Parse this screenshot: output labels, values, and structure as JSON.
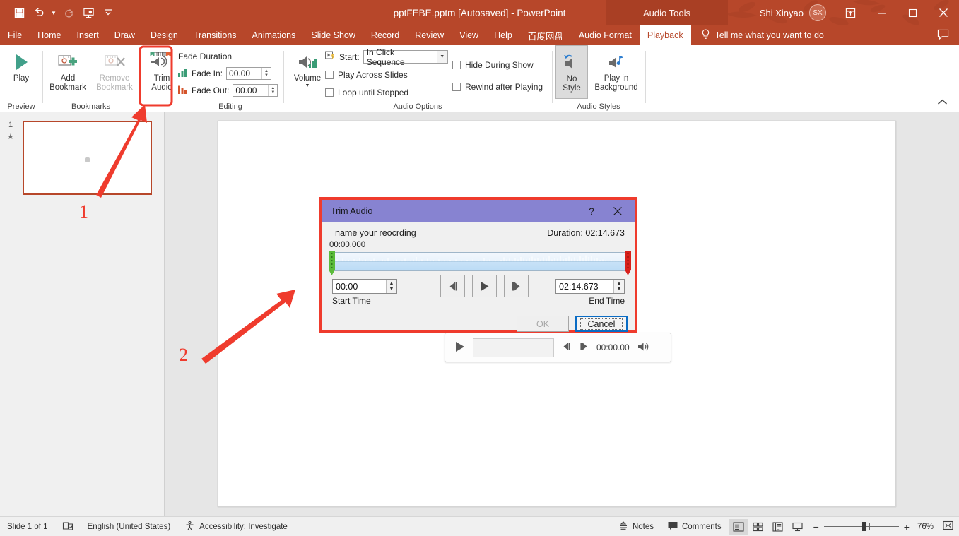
{
  "titlebar": {
    "document_title": "pptFEBE.pptm [Autosaved]  -  PowerPoint",
    "context_tools": "Audio Tools",
    "account_name": "Shi Xinyao",
    "avatar_initials": "SX",
    "quick_access": [
      {
        "name": "save-icon",
        "label": "Save"
      },
      {
        "name": "undo-icon",
        "label": "Undo"
      },
      {
        "name": "redo-icon",
        "label": "Redo"
      },
      {
        "name": "start-slideshow-icon",
        "label": "Start From Beginning"
      },
      {
        "name": "customize-qat-icon",
        "label": "Customize Quick Access Toolbar"
      }
    ],
    "window_buttons": [
      {
        "name": "ribbon-display-options",
        "glyph": "⬚"
      },
      {
        "name": "minimize",
        "glyph": "─"
      },
      {
        "name": "restore",
        "glyph": "☐"
      },
      {
        "name": "close",
        "glyph": "✕"
      }
    ]
  },
  "tabs": [
    {
      "label": "File",
      "active": false
    },
    {
      "label": "Home",
      "active": false
    },
    {
      "label": "Insert",
      "active": false
    },
    {
      "label": "Draw",
      "active": false
    },
    {
      "label": "Design",
      "active": false
    },
    {
      "label": "Transitions",
      "active": false
    },
    {
      "label": "Animations",
      "active": false
    },
    {
      "label": "Slide Show",
      "active": false
    },
    {
      "label": "Record",
      "active": false
    },
    {
      "label": "Review",
      "active": false
    },
    {
      "label": "View",
      "active": false
    },
    {
      "label": "Help",
      "active": false
    },
    {
      "label": "百度网盘",
      "active": false
    },
    {
      "label": "Audio Format",
      "active": false
    },
    {
      "label": "Playback",
      "active": true
    }
  ],
  "tell_me": {
    "placeholder": "Tell me what you want to do",
    "icon": "lightbulb-icon"
  },
  "ribbon": {
    "groups": [
      {
        "name": "preview",
        "label": "Preview"
      },
      {
        "name": "bookmarks",
        "label": "Bookmarks"
      },
      {
        "name": "editing",
        "label": "Editing"
      },
      {
        "name": "audio-options",
        "label": "Audio Options"
      },
      {
        "name": "audio-styles",
        "label": "Audio Styles"
      }
    ],
    "preview": {
      "play_label": "Play"
    },
    "bookmarks": {
      "add_label_line1": "Add",
      "add_label_line2": "Bookmark",
      "remove_label_line1": "Remove",
      "remove_label_line2": "Bookmark"
    },
    "editing": {
      "trim_label_line1": "Trim",
      "trim_label_line2": "Audio",
      "fade_duration_label": "Fade Duration",
      "fade_in_label": "Fade In:",
      "fade_in_value": "00.00",
      "fade_out_label": "Fade Out:",
      "fade_out_value": "00.00"
    },
    "audio_options": {
      "volume_label": "Volume",
      "start_label": "Start:",
      "start_value": "In Click Sequence",
      "play_across_slides": "Play Across Slides",
      "loop_until_stopped": "Loop until Stopped",
      "hide_during_show": "Hide During Show",
      "rewind_after_playing": "Rewind after Playing"
    },
    "audio_styles": {
      "no_style_line1": "No",
      "no_style_line2": "Style",
      "play_bg_line1": "Play in",
      "play_bg_line2": "Background"
    },
    "collapse_ribbon_icon": "chevron-up-icon"
  },
  "thumbnail_pane": {
    "slide_number": "1",
    "animation_marker": "★"
  },
  "audio_playbar": {
    "play_icon": "play-icon",
    "back_icon": "step-back-icon",
    "forward_icon": "step-forward-icon",
    "time": "00:00.00",
    "volume_icon": "volume-icon"
  },
  "trim_dialog": {
    "title": "Trim Audio",
    "help_glyph": "?",
    "close_glyph": "✕",
    "recording_name": "name your reocrding",
    "duration_label": "Duration: 02:14.673",
    "wave_start_label": "00:00.000",
    "start_time_value": "00:00",
    "start_time_label": "Start Time",
    "end_time_value": "02:14.673",
    "end_time_label": "End Time",
    "transport": [
      {
        "name": "previous-frame-button",
        "icon": "step-back-icon"
      },
      {
        "name": "play-button",
        "icon": "play-icon"
      },
      {
        "name": "next-frame-button",
        "icon": "step-forward-icon"
      }
    ],
    "ok_label": "OK",
    "cancel_label": "Cancel"
  },
  "statusbar": {
    "slide_indicator": "Slide 1 of 1",
    "spellcheck_icon": "spellcheck-icon",
    "language": "English (United States)",
    "accessibility": "Accessibility: Investigate",
    "notes_label": "Notes",
    "comments_label": "Comments",
    "views": [
      {
        "name": "normal-view-button",
        "active": true
      },
      {
        "name": "slide-sorter-button",
        "active": false
      },
      {
        "name": "reading-view-button",
        "active": false
      },
      {
        "name": "slideshow-button",
        "active": false
      }
    ],
    "zoom_out_glyph": "−",
    "zoom_in_glyph": "+",
    "zoom_level": "76%",
    "fit_slide_icon": "fit-to-window-icon"
  },
  "annotations": [
    {
      "label": "1",
      "target": "trim-audio-ribbon-button"
    },
    {
      "label": "2",
      "target": "trim-audio-dialog"
    }
  ],
  "colors": {
    "brand_red": "#b7472a",
    "annotation_red": "#ef3b2d",
    "dialog_title": "#8783d1",
    "focus_blue": "#0a6cc4"
  }
}
